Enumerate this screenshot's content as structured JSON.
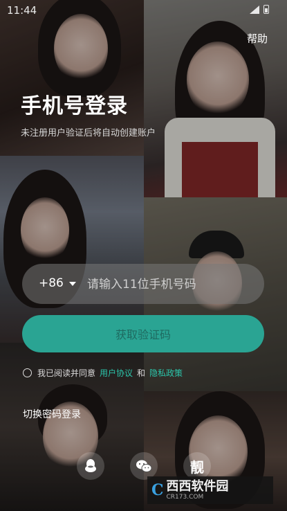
{
  "status_bar": {
    "time": "11:44"
  },
  "header": {
    "help_label": "帮助"
  },
  "login": {
    "title": "手机号登录",
    "subtitle": "未注册用户验证后将自动创建账户",
    "country_code": "+86",
    "phone_placeholder": "请输入11位手机号码",
    "get_code_label": "获取验证码"
  },
  "agreement": {
    "prefix": "我已阅读并同意",
    "user_agreement": "用户协议",
    "and": "和",
    "privacy_policy": "隐私政策"
  },
  "switch_password_login": "切换密码登录",
  "social": {
    "icons": [
      "qq-icon",
      "wechat-icon",
      "liang-icon"
    ],
    "liang_glyph": "靓"
  },
  "watermark": {
    "logo": "C",
    "brand": "西西软件园",
    "site": "CR173.COM"
  },
  "colors": {
    "accent": "#2aa493",
    "link": "#2cc6ab"
  }
}
